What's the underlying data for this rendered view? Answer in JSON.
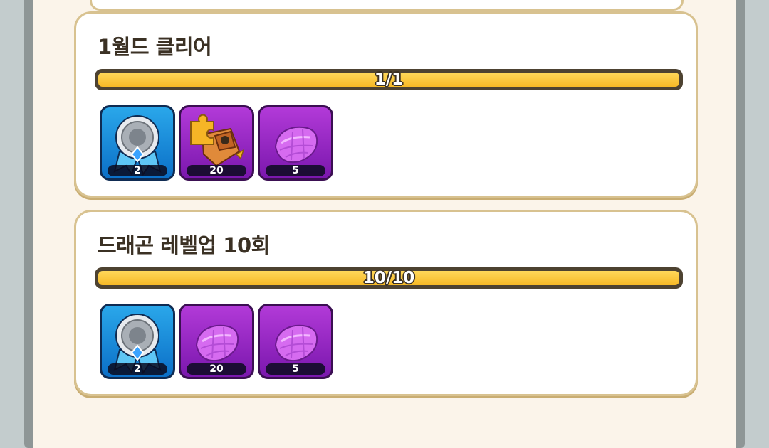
{
  "missions": [
    {
      "title": "1월드 클리어",
      "progress_text": "1/1",
      "progress": 1.0,
      "rewards": [
        {
          "icon": "silver-medal-icon",
          "quantity": "2",
          "color": "blue"
        },
        {
          "icon": "puzzle-treasure-chest-icon",
          "quantity": "20",
          "color": "purple"
        },
        {
          "icon": "purple-crystal-icon",
          "quantity": "5",
          "color": "purple"
        }
      ]
    },
    {
      "title": "드래곤 레벨업 10회",
      "progress_text": "10/10",
      "progress": 1.0,
      "rewards": [
        {
          "icon": "silver-medal-icon",
          "quantity": "2",
          "color": "blue"
        },
        {
          "icon": "purple-crystal-icon",
          "quantity": "20",
          "color": "purple"
        },
        {
          "icon": "purple-crystal-icon",
          "quantity": "5",
          "color": "purple"
        }
      ]
    }
  ],
  "colors": {
    "progress_fill": "#f7b926",
    "card_border": "#d8c290",
    "panel_bg": "#fbf4ea"
  }
}
